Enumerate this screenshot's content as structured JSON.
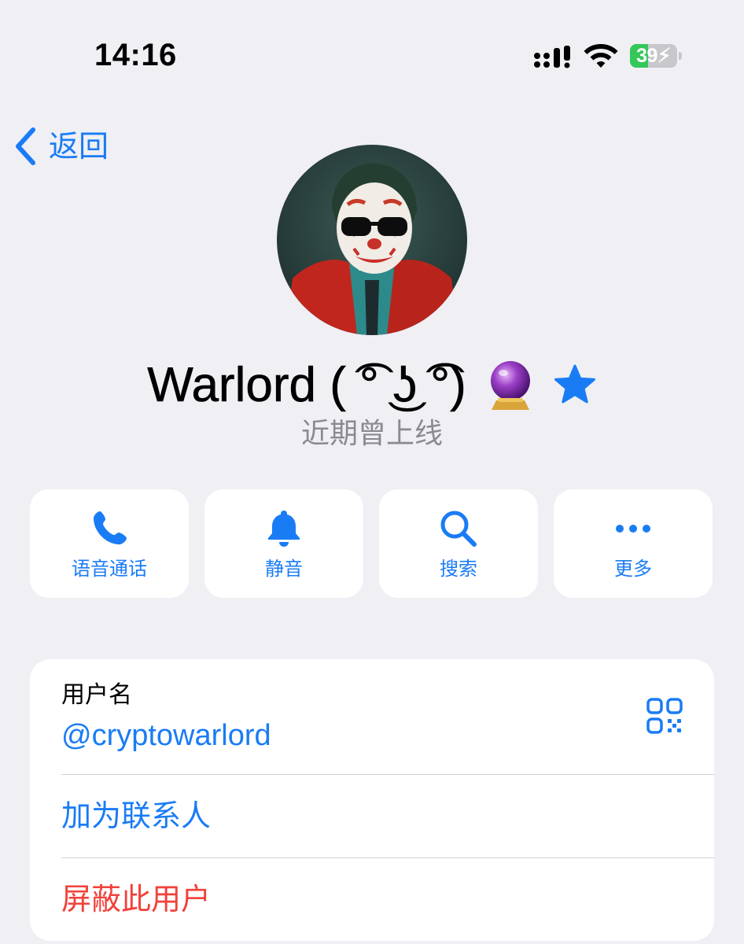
{
  "status_bar": {
    "time": "14:16",
    "battery_level": 39,
    "battery_text": "39",
    "battery_fill_color": "#34c759"
  },
  "nav": {
    "back_label": "返回",
    "back_icon": "chevron-left-icon"
  },
  "profile": {
    "name": "Warlord ( ͡° ͜ʖ ͡°)",
    "emoji_icon": "crystal-ball-icon",
    "badge_icon": "premium-star-icon",
    "status": "近期曾上线"
  },
  "actions": [
    {
      "label": "语音通话",
      "icon": "phone-icon"
    },
    {
      "label": "静音",
      "icon": "bell-icon"
    },
    {
      "label": "搜索",
      "icon": "search-icon"
    },
    {
      "label": "更多",
      "icon": "more-icon"
    }
  ],
  "info": {
    "username_title": "用户名",
    "username_value": "@cryptowarlord",
    "qr_icon": "qr-code-icon",
    "add_contact_label": "加为联系人",
    "block_label": "屏蔽此用户"
  },
  "colors": {
    "accent": "#1a7cf5",
    "destructive": "#f2413a",
    "background": "#efeff4",
    "secondary_text": "#8a8a8f"
  }
}
